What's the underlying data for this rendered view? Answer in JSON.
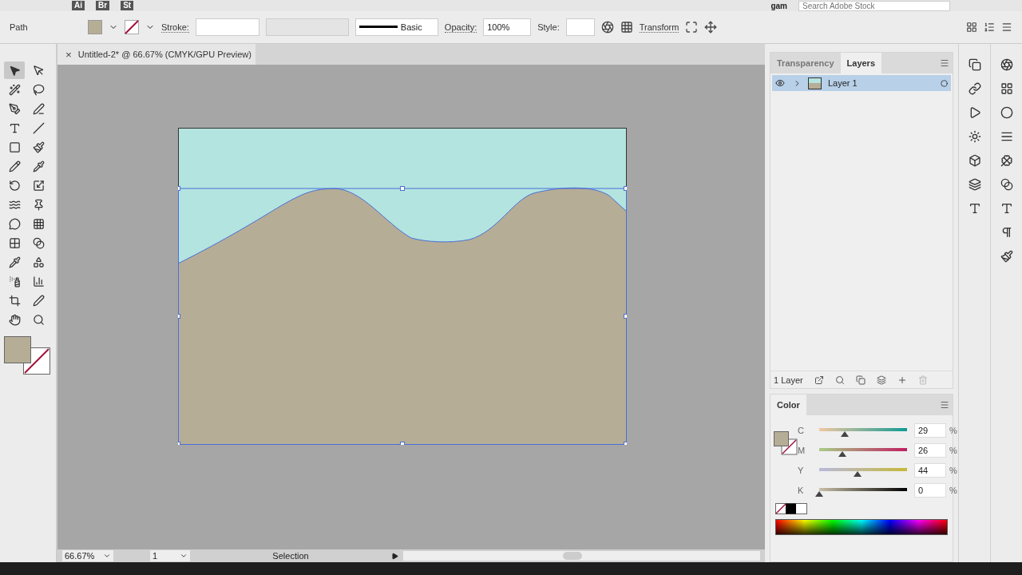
{
  "app_bar": {
    "apps": [
      "Ai",
      "Br",
      "St"
    ],
    "workspace": "gam",
    "search": {
      "placeholder": "Search Adobe Stock"
    }
  },
  "control_bar": {
    "selection_label": "Path",
    "stroke_label": "Stroke:",
    "brush": "Basic",
    "opacity_label": "Opacity:",
    "opacity": "100%",
    "style_label": "Style:",
    "transform": "Transform"
  },
  "document_tab": {
    "title": "Untitled-2* @ 66.67% (CMYK/GPU Preview)",
    "close": "×"
  },
  "tools": [
    {
      "selected": true
    },
    {
      "selected": false
    },
    {
      "selected": false
    },
    {
      "selected": false
    },
    {
      "selected": false
    },
    {
      "selected": false
    },
    {
      "selected": false
    },
    {
      "selected": false
    },
    {
      "selected": false
    },
    {
      "selected": false
    },
    {
      "selected": false
    },
    {
      "selected": false
    },
    {
      "selected": false
    },
    {
      "selected": false
    },
    {
      "selected": false
    },
    {
      "selected": false
    },
    {
      "selected": false
    },
    {
      "selected": false
    },
    {
      "selected": false
    },
    {
      "selected": false
    },
    {
      "selected": false
    },
    {
      "selected": false
    },
    {
      "selected": false
    },
    {
      "selected": false
    },
    {
      "selected": false
    },
    {
      "selected": false
    },
    {
      "selected": false
    },
    {
      "selected": false
    }
  ],
  "layers_panel": {
    "tabs": [
      {
        "label": "Transparency",
        "selected": false
      },
      {
        "label": "Layers",
        "selected": true
      }
    ],
    "layers": [
      {
        "name": "Layer 1",
        "visible": true,
        "expanded": false,
        "selected": true
      }
    ],
    "count": "1 Layer"
  },
  "color_panel": {
    "title": "Color",
    "channels": [
      {
        "label": "C",
        "level": 0.29,
        "value": "29",
        "unit": "%"
      },
      {
        "label": "M",
        "level": 0.26,
        "value": "26",
        "unit": "%"
      },
      {
        "label": "Y",
        "level": 0.44,
        "value": "44",
        "unit": "%"
      },
      {
        "label": "K",
        "level": 0,
        "value": "0",
        "unit": "%"
      }
    ]
  },
  "status_bar": {
    "zoom": "66.67%",
    "artboard": "1",
    "tool": "Selection"
  }
}
